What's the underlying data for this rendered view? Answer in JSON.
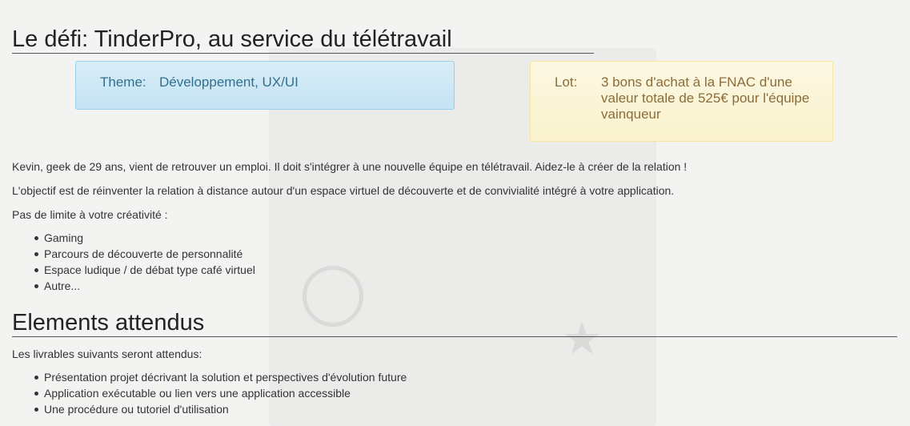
{
  "challenge": {
    "title": "Le défi: TinderPro, au service du télétravail",
    "theme_label": "Theme:",
    "theme_value": "Développement, UX/UI",
    "lot_label": "Lot:",
    "lot_value": "3 bons d'achat à la FNAC d'une valeur totale de 525€ pour l'équipe vainqueur",
    "intro": "Kevin, geek de 29 ans, vient de retrouver un emploi. Il doit s'intégrer à une nouvelle équipe en télétravail. Aidez-le à créer de la relation !",
    "objective": "L'objectif est de réinventer la relation à distance autour d'un espace virtuel de découverte et de convivialité intégré à votre application.",
    "creativity": "Pas de limite à votre créativité :",
    "ideas": [
      "Gaming",
      "Parcours de découverte de personnalité",
      "Espace ludique / de débat type café virtuel",
      "Autre..."
    ]
  },
  "deliverables": {
    "title": "Elements attendus",
    "intro": "Les livrables suivants seront attendus:",
    "items": [
      "Présentation projet décrivant la solution et perspectives d'évolution future",
      "Application exécutable ou lien vers une application accessible",
      "Une procédure ou tutoriel d'utilisation"
    ]
  },
  "colors": {
    "info_bg": "#d9edf7",
    "info_text": "#31708f",
    "warning_bg": "#fcf8e3",
    "warning_text": "#8a6d3b"
  }
}
